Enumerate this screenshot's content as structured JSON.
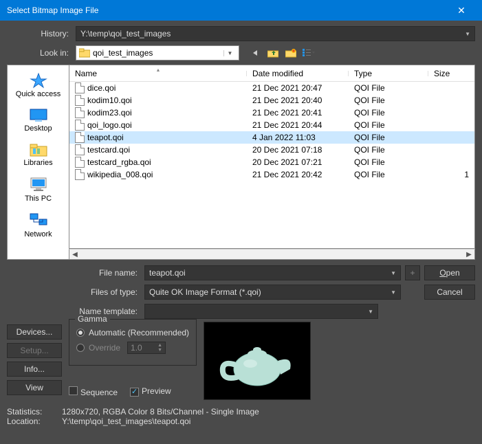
{
  "title": "Select Bitmap Image File",
  "labels": {
    "history": "History:",
    "look_in": "Look in:",
    "file_name": "File name:",
    "files_of_type": "Files of type:",
    "name_template": "Name template:",
    "gamma": "Gamma",
    "statistics": "Statistics:",
    "location": "Location:"
  },
  "history_value": "Y:\\temp\\qoi_test_images",
  "look_in_value": "qoi_test_images",
  "places": [
    {
      "key": "quick-access",
      "label": "Quick access"
    },
    {
      "key": "desktop",
      "label": "Desktop"
    },
    {
      "key": "libraries",
      "label": "Libraries"
    },
    {
      "key": "this-pc",
      "label": "This PC"
    },
    {
      "key": "network",
      "label": "Network"
    }
  ],
  "columns": {
    "name": "Name",
    "date": "Date modified",
    "type": "Type",
    "size": "Size"
  },
  "files": [
    {
      "name": "dice.qoi",
      "date": "21 Dec 2021 20:47",
      "type": "QOI File",
      "size": "",
      "selected": false
    },
    {
      "name": "kodim10.qoi",
      "date": "21 Dec 2021 20:40",
      "type": "QOI File",
      "size": "",
      "selected": false
    },
    {
      "name": "kodim23.qoi",
      "date": "21 Dec 2021 20:41",
      "type": "QOI File",
      "size": "",
      "selected": false
    },
    {
      "name": "qoi_logo.qoi",
      "date": "21 Dec 2021 20:44",
      "type": "QOI File",
      "size": "",
      "selected": false
    },
    {
      "name": "teapot.qoi",
      "date": "4 Jan 2022 11:03",
      "type": "QOI File",
      "size": "",
      "selected": true
    },
    {
      "name": "testcard.qoi",
      "date": "20 Dec 2021 07:18",
      "type": "QOI File",
      "size": "",
      "selected": false
    },
    {
      "name": "testcard_rgba.qoi",
      "date": "20 Dec 2021 07:21",
      "type": "QOI File",
      "size": "",
      "selected": false
    },
    {
      "name": "wikipedia_008.qoi",
      "date": "21 Dec 2021 20:42",
      "type": "QOI File",
      "size": "1",
      "selected": false
    }
  ],
  "file_name_value": "teapot.qoi",
  "file_type_value": "Quite OK Image Format (*.qoi)",
  "name_template_value": "",
  "buttons": {
    "open": "Open",
    "cancel": "Cancel",
    "devices": "Devices...",
    "setup": "Setup...",
    "info": "Info...",
    "view": "View",
    "plus": "+"
  },
  "gamma": {
    "automatic": "Automatic (Recommended)",
    "override": "Override",
    "override_value": "1.0"
  },
  "checks": {
    "sequence": "Sequence",
    "preview": "Preview"
  },
  "statistics_value": "1280x720, RGBA Color 8 Bits/Channel - Single Image",
  "location_value": "Y:\\temp\\qoi_test_images\\teapot.qoi"
}
